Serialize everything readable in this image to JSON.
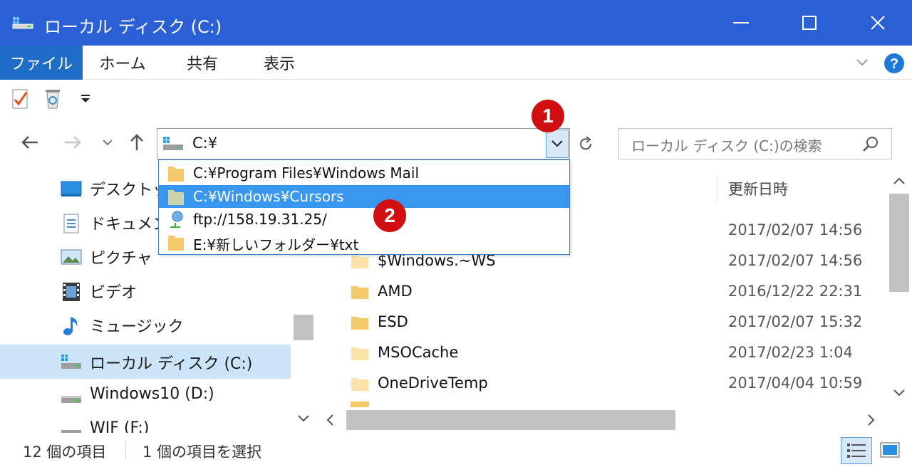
{
  "window": {
    "title": "ローカル ディスク (C:)"
  },
  "ribbon": {
    "tabs": [
      "ファイル",
      "ホーム",
      "共有",
      "表示"
    ]
  },
  "address": {
    "path": "C:¥"
  },
  "search": {
    "placeholder": "ローカル ディスク (C:)の検索"
  },
  "dropdown": {
    "items": [
      "C:¥Program Files¥Windows Mail",
      "C:¥Windows¥Cursors",
      "ftp://158.19.31.25/",
      "E:¥新しいフォルダー¥txt"
    ],
    "selected_index": 1
  },
  "nav_pane": {
    "items": [
      {
        "label": "デスクトップ",
        "icon": "desktop-icon"
      },
      {
        "label": "ドキュメント",
        "icon": "documents-icon"
      },
      {
        "label": "ピクチャ",
        "icon": "pictures-icon"
      },
      {
        "label": "ビデオ",
        "icon": "videos-icon"
      },
      {
        "label": "ミュージック",
        "icon": "music-icon"
      },
      {
        "label": "ローカル ディスク (C:)",
        "icon": "local-disk-icon"
      },
      {
        "label": "Windows10 (D:)",
        "icon": "drive-icon"
      },
      {
        "label": "WIF (F:)",
        "icon": "drive-icon"
      }
    ],
    "selected_index": 5
  },
  "file_list": {
    "columns": {
      "date": "更新日時"
    },
    "rows": [
      {
        "name": "",
        "date": "2017/02/07 14:56"
      },
      {
        "name": "$Windows.~WS",
        "date": "2017/02/07 14:56"
      },
      {
        "name": "AMD",
        "date": "2016/12/22 22:31"
      },
      {
        "name": "ESD",
        "date": "2017/02/07 15:32"
      },
      {
        "name": "MSOCache",
        "date": "2017/02/23 1:04"
      },
      {
        "name": "OneDriveTemp",
        "date": "2017/04/04 10:59"
      }
    ]
  },
  "status": {
    "item_count": "12 個の項目",
    "selection": "1 個の項目を選択"
  },
  "callouts": [
    "1",
    "2"
  ],
  "colors": {
    "titlebar": "#2b5fd6",
    "file_tab": "#1e6ec8",
    "selection": "#3a97f0",
    "callout": "#d10f10",
    "folder": "#f5c86a"
  }
}
